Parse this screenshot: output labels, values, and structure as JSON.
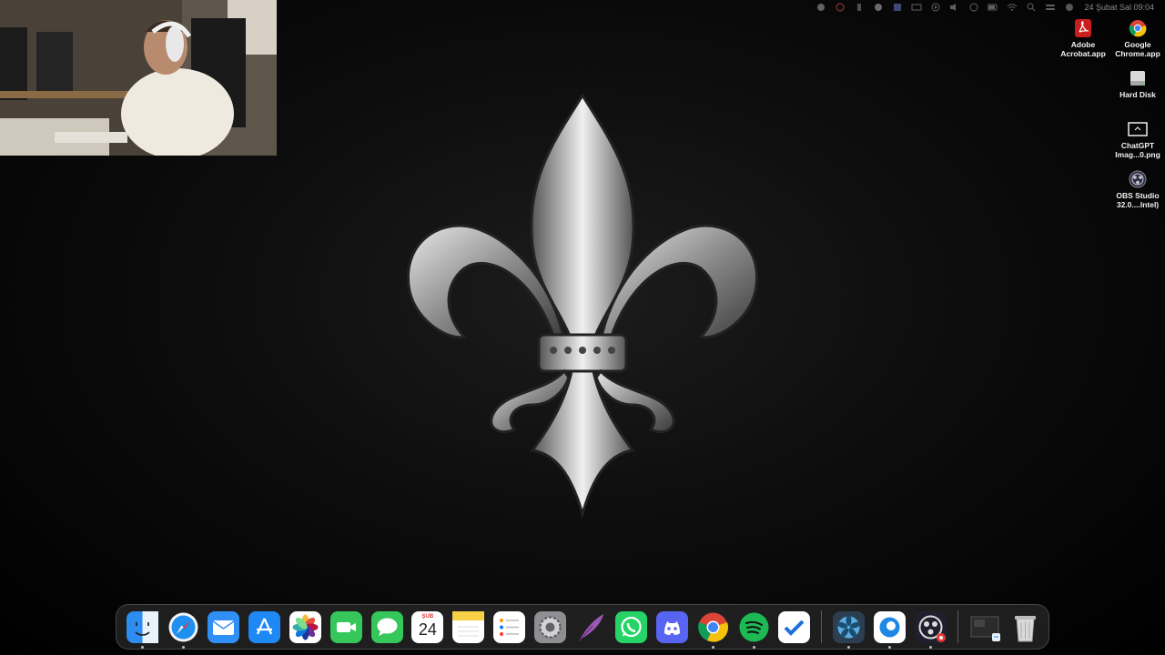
{
  "menubar": {
    "status_icons": [
      "creative-cloud-icon",
      "screen-record-icon",
      "battery-small-icon",
      "vpn-icon",
      "display-icon",
      "keyboard-icon",
      "play-icon",
      "volume-icon",
      "user-icon",
      "battery-icon",
      "wifi-icon",
      "search-icon",
      "control-center-icon",
      "siri-icon"
    ],
    "clock": "24 Şubat Sal  09:04"
  },
  "webcam": {
    "description_visible": false
  },
  "desktop_icons": [
    {
      "name": "adobe-acrobat-app",
      "label": "Adobe\nAcrobat.app",
      "icon": "acrobat-icon",
      "color": "#c81e1e"
    },
    {
      "name": "google-chrome-app",
      "label": "Google\nChrome.app",
      "icon": "chrome-icon",
      "color": "#4285f4"
    },
    {
      "name": "hard-disk",
      "label": "Hard Disk",
      "icon": "hard-disk-icon",
      "color": "#cfcfcf"
    },
    {
      "name": "chatgpt-image",
      "label": "ChatGPT\nImag...0.png",
      "icon": "image-file-icon",
      "color": "#ffffff"
    },
    {
      "name": "obs-studio",
      "label": "OBS Studio\n32.0....Intel)",
      "icon": "obs-icon",
      "color": "#3d3d6b"
    }
  ],
  "dock": {
    "calendar_month": "ŞUB",
    "calendar_day": "24",
    "apps": [
      {
        "name": "finder",
        "icon": "finder-icon",
        "running": true
      },
      {
        "name": "safari",
        "icon": "safari-icon",
        "running": true
      },
      {
        "name": "mail",
        "icon": "mail-icon",
        "running": false
      },
      {
        "name": "app-store",
        "icon": "app-store-icon",
        "running": false
      },
      {
        "name": "photos",
        "icon": "photos-icon",
        "running": false
      },
      {
        "name": "facetime",
        "icon": "facetime-icon",
        "running": false
      },
      {
        "name": "messages",
        "icon": "messages-icon",
        "running": false
      },
      {
        "name": "calendar",
        "icon": "calendar-icon",
        "running": false
      },
      {
        "name": "notes",
        "icon": "notes-icon",
        "running": false
      },
      {
        "name": "reminders",
        "icon": "reminders-icon",
        "running": false
      },
      {
        "name": "system-settings",
        "icon": "settings-icon",
        "running": false
      },
      {
        "name": "quill-app",
        "icon": "quill-icon",
        "running": false
      },
      {
        "name": "whatsapp",
        "icon": "whatsapp-icon",
        "running": false
      },
      {
        "name": "discord",
        "icon": "discord-icon",
        "running": false
      },
      {
        "name": "chrome",
        "icon": "chrome-icon",
        "running": true
      },
      {
        "name": "spotify",
        "icon": "spotify-icon",
        "running": true
      },
      {
        "name": "tasks",
        "icon": "checkmark-icon",
        "running": false
      },
      {
        "name": "macs-fan-control",
        "icon": "fan-icon",
        "running": true
      },
      {
        "name": "edge-app",
        "icon": "edge-icon",
        "running": true
      },
      {
        "name": "obs-studio",
        "icon": "obs-icon",
        "running": true
      },
      {
        "name": "downloads-stack",
        "icon": "downloads-stack-icon",
        "running": false
      },
      {
        "name": "trash",
        "icon": "trash-icon",
        "running": false
      }
    ]
  },
  "colors": {
    "background": "#000000",
    "dock_bg": "#282828",
    "dock_dot": "#bbbbbb"
  }
}
